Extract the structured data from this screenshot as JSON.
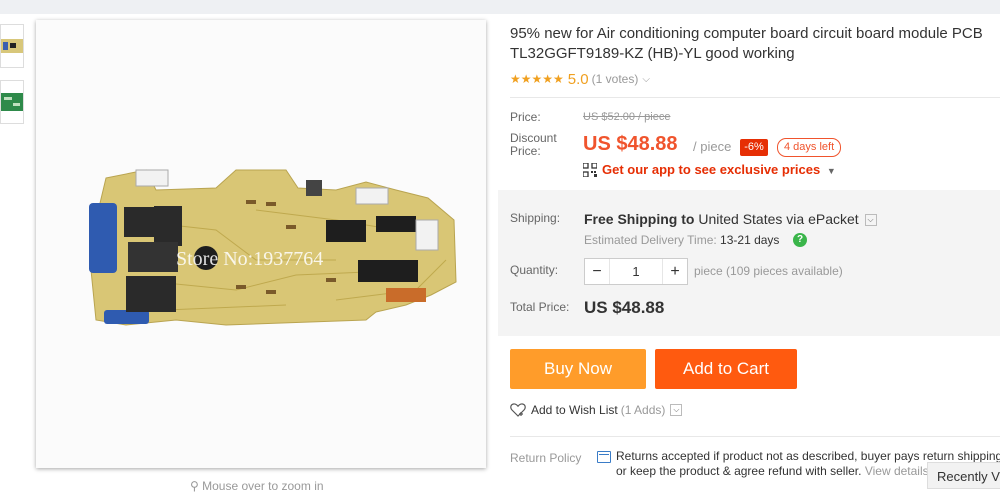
{
  "product": {
    "title_line1": "95% new for Air conditioning computer board circuit board module PCB",
    "title_line2": "TL32GGFT9189-KZ (HB)-YL good working",
    "stars": "★★★★★",
    "rating": "5.0",
    "votes": "(1 votes)",
    "watermark": "Store No:1937764"
  },
  "gallery": {
    "zoom_hint": "Mouse over to zoom in"
  },
  "pricing": {
    "price_label": "Price:",
    "original_price": "US $52.00 / piece",
    "discount_label_1": "Discount",
    "discount_label_2": "Price:",
    "discount_price": "US $48.88",
    "per_piece": "/ piece",
    "discount_badge": "-6%",
    "days_left": "4 days left",
    "app_prices": "Get our app to see exclusive prices"
  },
  "shipping": {
    "label": "Shipping:",
    "free_shipping": "Free Shipping to",
    "destination": "United States via ePacket",
    "eta_label": "Estimated Delivery Time:",
    "eta_value": "13-21  days"
  },
  "quantity": {
    "label": "Quantity:",
    "value": "1",
    "minus": "−",
    "plus": "+",
    "note": "piece (109 pieces available)"
  },
  "total": {
    "label": "Total Price:",
    "value": "US $48.88"
  },
  "actions": {
    "buy_now": "Buy Now",
    "add_to_cart": "Add to Cart",
    "wishlist": "Add to Wish List",
    "wishlist_count": "(1 Adds)"
  },
  "returns": {
    "label": "Return Policy",
    "line1": "Returns accepted if product not as described, buyer pays return shipping",
    "line2": "or keep the product & agree refund with seller.",
    "link": "View details"
  },
  "recently_viewed": "Recently Viewed",
  "colors": {
    "accent": "#f0542d",
    "buy_now": "#ff9c2a",
    "add_to_cart": "#ff5a0f",
    "stars": "#f0a020"
  }
}
